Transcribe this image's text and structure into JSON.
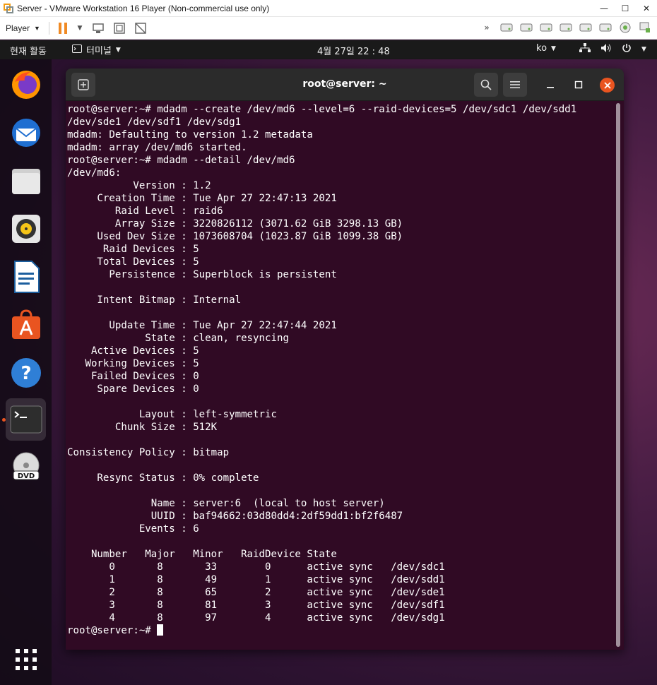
{
  "vmware": {
    "title": "Server - VMware Workstation 16 Player (Non-commercial use only)",
    "player_menu": "Player",
    "window_controls": [
      "minimize-icon",
      "maximize-icon",
      "close-icon"
    ],
    "device_icons": [
      "double-chevron-icon",
      "hdd-icon",
      "hdd-icon",
      "hdd-icon",
      "hdd-icon",
      "hdd-icon",
      "hdd-icon",
      "network-icon",
      "usb-icon"
    ]
  },
  "topbar": {
    "activities": "현재 활동",
    "app_name": "터미널",
    "clock": "4월 27일  22 : 48",
    "language": "ko"
  },
  "dock": {
    "items": [
      {
        "name": "firefox-icon"
      },
      {
        "name": "thunderbird-icon"
      },
      {
        "name": "files-icon"
      },
      {
        "name": "rhythmbox-icon"
      },
      {
        "name": "libreoffice-writer-icon"
      },
      {
        "name": "ubuntu-software-icon"
      },
      {
        "name": "help-icon"
      },
      {
        "name": "terminal-icon",
        "active": true
      },
      {
        "name": "dvd-icon"
      }
    ],
    "show_apps": "app-grid-icon"
  },
  "terminal": {
    "title": "root@server: ~",
    "colors": {
      "background": "#300a24",
      "foreground": "#ffffff",
      "close": "#e95420"
    },
    "lines": [
      "root@server:~# mdadm --create /dev/md6 --level=6 --raid-devices=5 /dev/sdc1 /dev/sdd1",
      "/dev/sde1 /dev/sdf1 /dev/sdg1",
      "mdadm: Defaulting to version 1.2 metadata",
      "mdadm: array /dev/md6 started.",
      "root@server:~# mdadm --detail /dev/md6",
      "/dev/md6:",
      "           Version : 1.2",
      "     Creation Time : Tue Apr 27 22:47:13 2021",
      "        Raid Level : raid6",
      "        Array Size : 3220826112 (3071.62 GiB 3298.13 GB)",
      "     Used Dev Size : 1073608704 (1023.87 GiB 1099.38 GB)",
      "      Raid Devices : 5",
      "     Total Devices : 5",
      "       Persistence : Superblock is persistent",
      "",
      "     Intent Bitmap : Internal",
      "",
      "       Update Time : Tue Apr 27 22:47:44 2021",
      "             State : clean, resyncing",
      "    Active Devices : 5",
      "   Working Devices : 5",
      "    Failed Devices : 0",
      "     Spare Devices : 0",
      "",
      "            Layout : left-symmetric",
      "        Chunk Size : 512K",
      "",
      "Consistency Policy : bitmap",
      "",
      "     Resync Status : 0% complete",
      "",
      "              Name : server:6  (local to host server)",
      "              UUID : baf94662:03d80dd4:2df59dd1:bf2f6487",
      "            Events : 6",
      "",
      "    Number   Major   Minor   RaidDevice State",
      "       0       8       33        0      active sync   /dev/sdc1",
      "       1       8       49        1      active sync   /dev/sdd1",
      "       2       8       65        2      active sync   /dev/sde1",
      "       3       8       81        3      active sync   /dev/sdf1",
      "       4       8       97        4      active sync   /dev/sdg1"
    ],
    "prompt": "root@server:~# "
  }
}
